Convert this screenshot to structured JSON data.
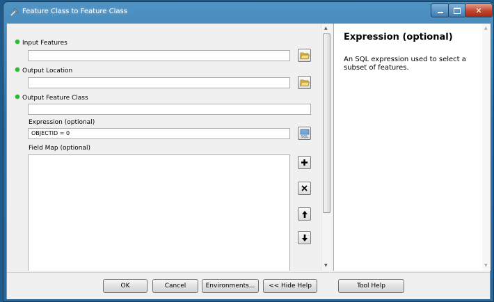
{
  "window": {
    "title": "Feature Class to Feature Class"
  },
  "params": {
    "input_features": {
      "label": "Input Features",
      "value": ""
    },
    "output_location": {
      "label": "Output Location",
      "value": ""
    },
    "output_feature_class": {
      "label": "Output Feature Class",
      "value": ""
    },
    "expression": {
      "label": "Expression (optional)",
      "value": "OBJECTID = 0"
    },
    "field_map": {
      "label": "Field Map (optional)"
    }
  },
  "help": {
    "title": "Expression (optional)",
    "body": "An SQL expression used to select a subset of features."
  },
  "buttons": {
    "ok": "OK",
    "cancel": "Cancel",
    "environments": "Environments...",
    "hide_help": "<< Hide Help",
    "tool_help": "Tool Help"
  },
  "icons": {
    "browse": "folder-open-icon",
    "sql": "sql-icon",
    "add": "plus-icon",
    "delete": "x-icon",
    "up": "arrow-up-icon",
    "down": "arrow-down-icon"
  },
  "colors": {
    "required_dot": "#1fc12a",
    "title_bar": "#2f6fa3",
    "close_button": "#c0442c"
  }
}
